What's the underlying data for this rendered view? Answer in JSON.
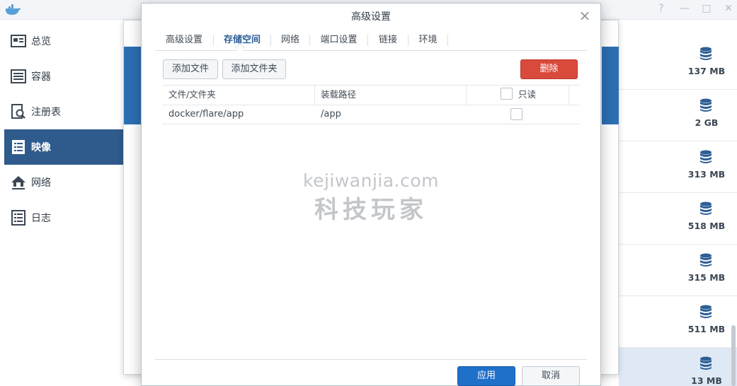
{
  "sidebar": {
    "items": [
      {
        "label": "总览",
        "icon": "overview-icon"
      },
      {
        "label": "容器",
        "icon": "container-icon"
      },
      {
        "label": "注册表",
        "icon": "registry-icon"
      },
      {
        "label": "映像",
        "icon": "image-icon",
        "active": true
      },
      {
        "label": "网络",
        "icon": "network-icon"
      },
      {
        "label": "日志",
        "icon": "log-icon"
      }
    ]
  },
  "images": {
    "sizes": [
      "137 MB",
      "2 GB",
      "313 MB",
      "518 MB",
      "315 MB",
      "511 MB",
      "13 MB"
    ]
  },
  "dialog": {
    "title": "高级设置",
    "close_glyph": "×",
    "tabs": [
      "高级设置",
      "存储空间",
      "网络",
      "端口设置",
      "链接",
      "环境"
    ],
    "active_tab": "存储空间",
    "buttons": {
      "add_file": "添加文件",
      "add_folder": "添加文件夹",
      "delete": "删除",
      "apply": "应用",
      "cancel": "取消"
    },
    "table": {
      "headers": [
        "文件/文件夹",
        "装载路径",
        "只读"
      ],
      "rows": [
        {
          "file": "docker/flare/app",
          "mount_path": "/app",
          "readonly": false
        }
      ]
    }
  },
  "watermark": {
    "url": "kejiwanjia.com",
    "cn": "科技玩家"
  },
  "colors": {
    "sidebar_active": "#2f5a8c",
    "delete_button": "#d9493c",
    "apply_button": "#1f70c9",
    "active_tab": "#2a5c95"
  }
}
